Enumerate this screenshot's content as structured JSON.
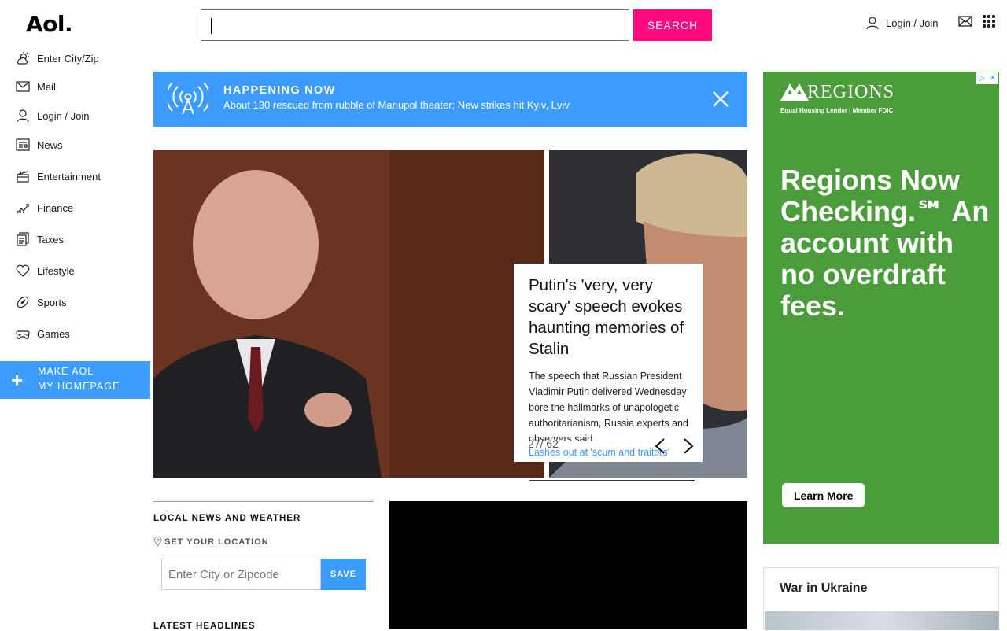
{
  "header": {
    "logo": "Aol.",
    "search_placeholder": "",
    "search_button": "SEARCH",
    "login_label": "Login / Join"
  },
  "sidebar": {
    "items": [
      {
        "label": "Enter City/Zip",
        "icon": "weather-icon"
      },
      {
        "label": "Mail",
        "icon": "mail-icon"
      },
      {
        "label": "Login / Join",
        "icon": "user-icon"
      },
      {
        "label": "News",
        "icon": "news-icon"
      },
      {
        "label": "Entertainment",
        "icon": "clapperboard-icon"
      },
      {
        "label": "Finance",
        "icon": "chart-icon"
      },
      {
        "label": "Taxes",
        "icon": "document-icon"
      },
      {
        "label": "Lifestyle",
        "icon": "heart-icon"
      },
      {
        "label": "Sports",
        "icon": "football-icon"
      },
      {
        "label": "Games",
        "icon": "gamepad-icon"
      }
    ],
    "make_home_line1": "MAKE AOL",
    "make_home_line2": "MY HOMEPAGE"
  },
  "banner": {
    "title": "HAPPENING NOW",
    "text": "About 130 rescued from rubble of Mariupol theater; New strikes hit Kyiv, Lviv"
  },
  "hero": {
    "headline": "Putin's 'very, very scary' speech evokes haunting memories of Stalin",
    "summary": "The speech that Russian President Vladimir Putin delivered Wednesday bore the hallmarks of unapologetic authoritarianism, Russia experts and observers said.",
    "link": "Lashes out at 'scum and traitors'",
    "counter": "27/ 62"
  },
  "local": {
    "title": "LOCAL NEWS AND WEATHER",
    "set_location": "SET YOUR LOCATION",
    "city_placeholder": "Enter City or Zipcode",
    "save": "SAVE",
    "latest": "LATEST HEADLINES"
  },
  "ad": {
    "brand": "REGIONS",
    "tagline": "Equal Housing Lender | Member FDIC",
    "headline": "Regions Now Checking.℠ An account with no overdraft fees.",
    "button": "Learn More",
    "accent": "#4a9d3a"
  },
  "war_box": {
    "title": "War in Ukraine"
  },
  "colors": {
    "accent_blue": "#3c9bff",
    "search_pink": "#ff0b7e"
  }
}
